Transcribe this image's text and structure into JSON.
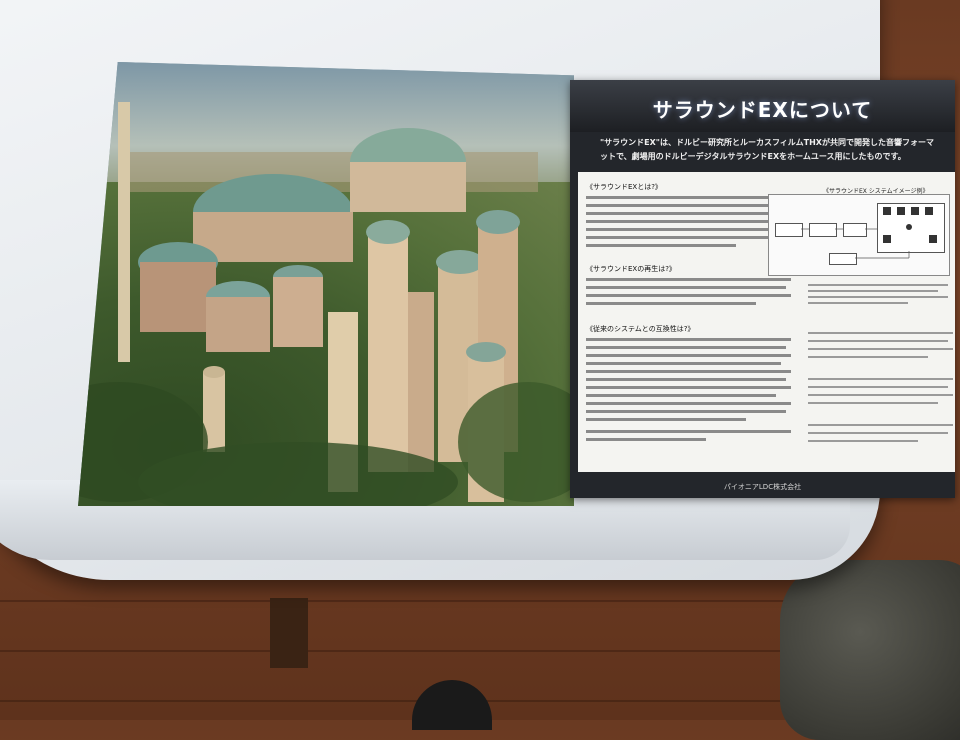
{
  "booklet": {
    "title": "サラウンドEXについて",
    "lead": "\"サラウンドEX\"は、ドルビー研究所とルーカスフィルムTHXが共同で開発した音響フォーマットで、劇場用のドルビーデジタルサラウンドEXをホームユース用にしたものです。",
    "sections": [
      {
        "heading": "《サラウンドEXとは?》"
      },
      {
        "heading": "《サラウンドEXの再生は?》"
      },
      {
        "heading": "《従来のシステムとの互換性は?》"
      }
    ],
    "system_label": "《サラウンドEX システムイメージ例》",
    "footer": "パイオニアLDC株式会社"
  }
}
